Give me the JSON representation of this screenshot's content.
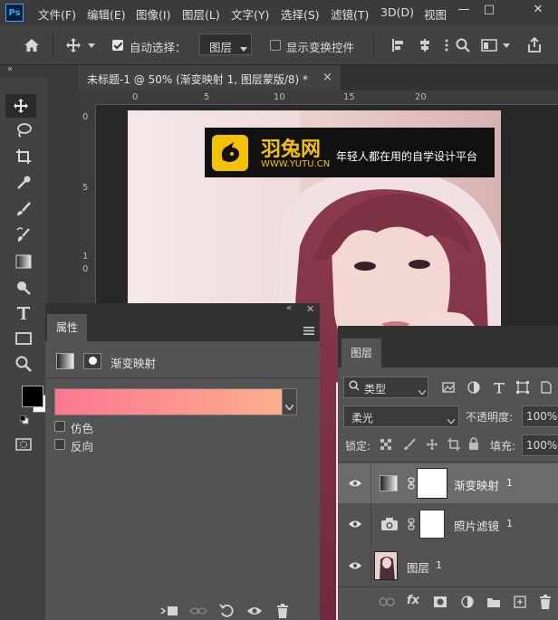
{
  "menubar": {
    "logo": "Ps",
    "items": [
      "文件(F)",
      "编辑(E)",
      "图像(I)",
      "图层(L)",
      "文字(Y)",
      "选择(S)",
      "滤镜(T)",
      "3D(D)",
      "视图"
    ],
    "window_buttons": [
      "—",
      "□",
      "✕"
    ]
  },
  "options_bar": {
    "auto_select_label": "自动选择：",
    "auto_select_checked": true,
    "auto_select_target": "图层",
    "show_transform_label": "显示变换控件",
    "show_transform_checked": false
  },
  "document": {
    "tab_title": "未标题-1 @ 50% (渐变映射 1, 图层蒙版/8) *",
    "tab_close": "×",
    "ruler_h": [
      "0",
      "5",
      "10",
      "15",
      "20"
    ],
    "ruler_v": [
      "0",
      "5",
      "1",
      "0"
    ]
  },
  "watermark": {
    "logo_text": "羽兔网",
    "url": "WWW.YUTU.CN",
    "slogan": "年轻人都在用的自学设计平台"
  },
  "properties_panel": {
    "tab_label": "属性",
    "adjustment_title": "渐变映射",
    "gradient_colors": [
      "#fb7791",
      "#fcaf8d"
    ],
    "dither_label": "仿色",
    "reverse_label": "反向",
    "dither_checked": false,
    "reverse_checked": false
  },
  "layers_panel": {
    "tab_label": "图层",
    "filter_kind": "类型",
    "blend_mode": "柔光",
    "opacity_label": "不透明度:",
    "opacity_value": "100%",
    "lock_label": "锁定:",
    "fill_label": "填充:",
    "fill_value": "100%",
    "layers": [
      {
        "name": "渐变映射",
        "suffix": "1",
        "selected": true,
        "icon": "gradient-map-icon"
      },
      {
        "name": "照片滤镜",
        "suffix": "1",
        "selected": false,
        "icon": "photo-filter-icon"
      },
      {
        "name": "图层",
        "suffix": "1",
        "selected": false,
        "icon": "photo-thumbnail"
      }
    ]
  },
  "colors": {
    "app_bg": "#535353",
    "menubar": "#3b3b3b",
    "panel_header": "#323232",
    "selected_layer": "#6b6b6b",
    "accent_gold": "#f5c200"
  }
}
